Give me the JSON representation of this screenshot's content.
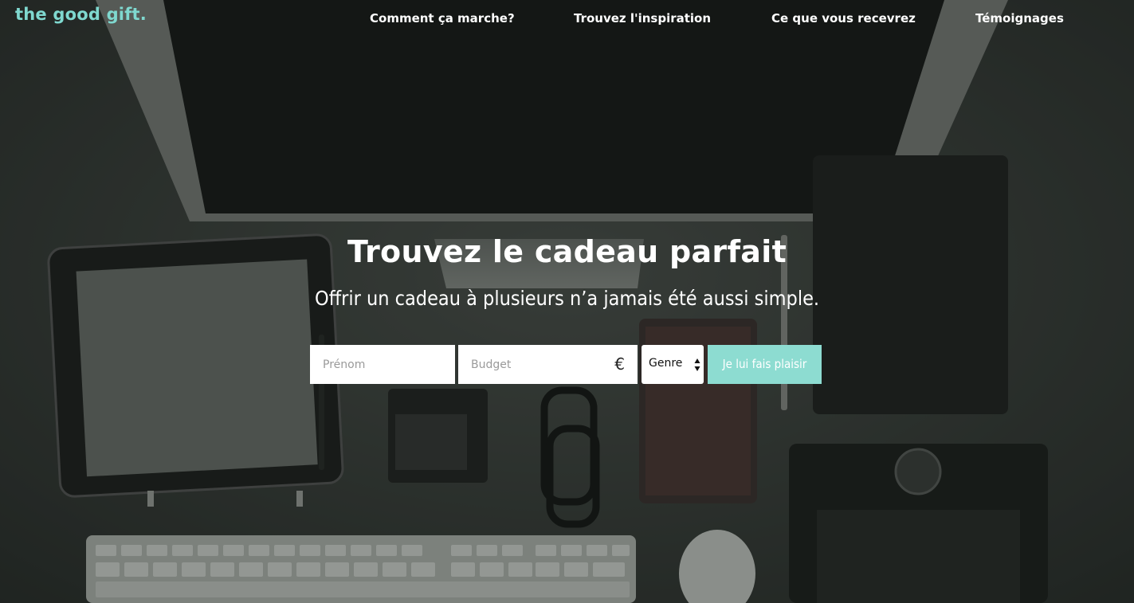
{
  "brand": {
    "logo_text": "the good gift.",
    "accent_color": "#7fd8cf",
    "cta_color": "#8ddcd1"
  },
  "nav": {
    "items": [
      {
        "label": "Comment ça marche?"
      },
      {
        "label": "Trouvez l'inspiration"
      },
      {
        "label": "Ce que vous recevrez"
      },
      {
        "label": "Témoignages"
      }
    ]
  },
  "hero": {
    "title": "Trouvez le cadeau parfait",
    "subtitle": "Offrir un cadeau à plusieurs n’a jamais été aussi simple.",
    "background_image": "desk-flatlay-photo"
  },
  "form": {
    "firstname_placeholder": "Prénom",
    "budget_placeholder": "Budget",
    "currency_symbol": "€",
    "gender_selected": "Genre",
    "submit_label": "Je lui fais plaisir"
  }
}
